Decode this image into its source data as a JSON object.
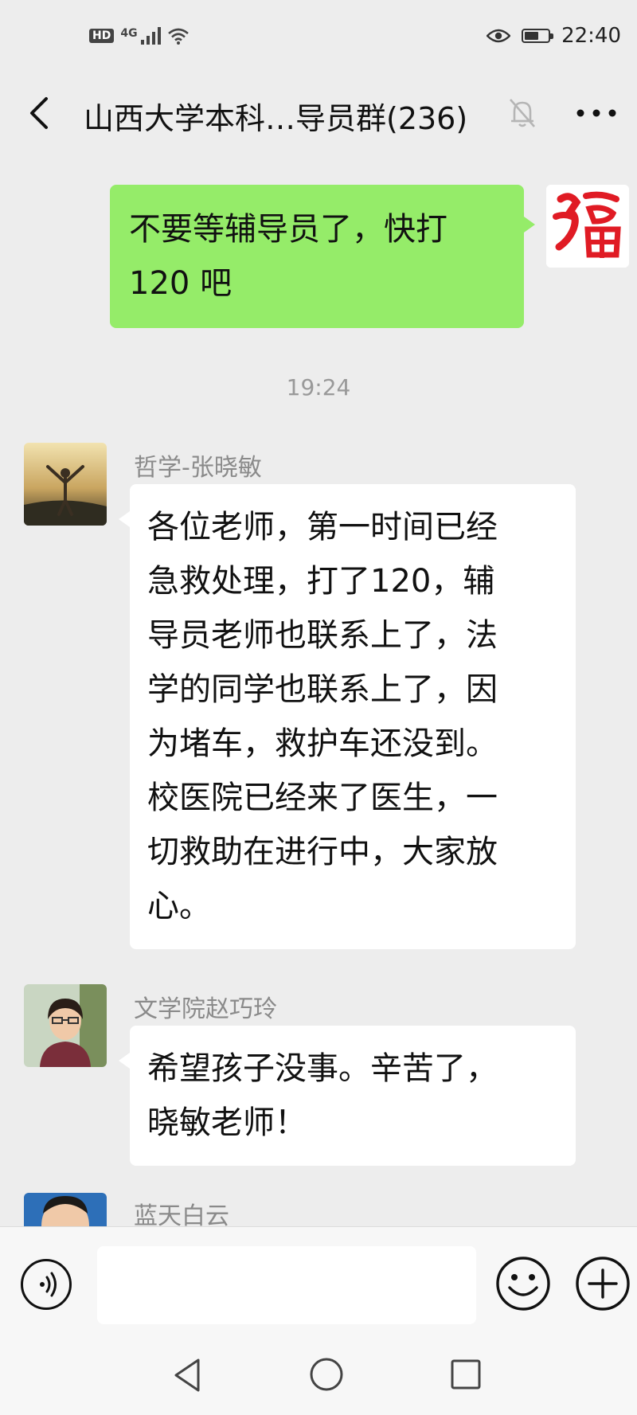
{
  "status_bar": {
    "hd": "HD",
    "network": "4G",
    "time": "22:40",
    "battery_level": 0.6
  },
  "header": {
    "title": "山西大学本科…导员群(236)"
  },
  "messages": [
    {
      "side": "right",
      "text_lines": [
        "不要等辅导员了，快打",
        "120 吧"
      ],
      "avatar": "fu-character-avatar"
    },
    {
      "type": "timestamp",
      "text": "19:24"
    },
    {
      "side": "left",
      "sender": "哲学-张晓敏",
      "text_lines": [
        "各位老师，第一时间已经",
        "急救处理，打了120，辅",
        "导员老师也联系上了，法",
        "学的同学也联系上了，因",
        "为堵车，救护车还没到。",
        "校医院已经来了医生，一",
        "切救助在进行中，大家放",
        "心。"
      ]
    },
    {
      "side": "left",
      "sender": "文学院赵巧玲",
      "text_lines": [
        "希望孩子没事。辛苦了，",
        "晓敏老师！"
      ]
    },
    {
      "side": "left",
      "sender": "蓝天白云"
    }
  ],
  "colors": {
    "background": "#ededed",
    "my_bubble": "#95ec69",
    "other_bubble": "#ffffff",
    "sender_name": "#8a8a8a"
  },
  "icons": [
    "back-icon",
    "mute-bell-icon",
    "more-icon",
    "voice-icon",
    "emoji-icon",
    "plus-icon",
    "nav-back-icon",
    "nav-home-icon",
    "nav-recent-icon"
  ]
}
